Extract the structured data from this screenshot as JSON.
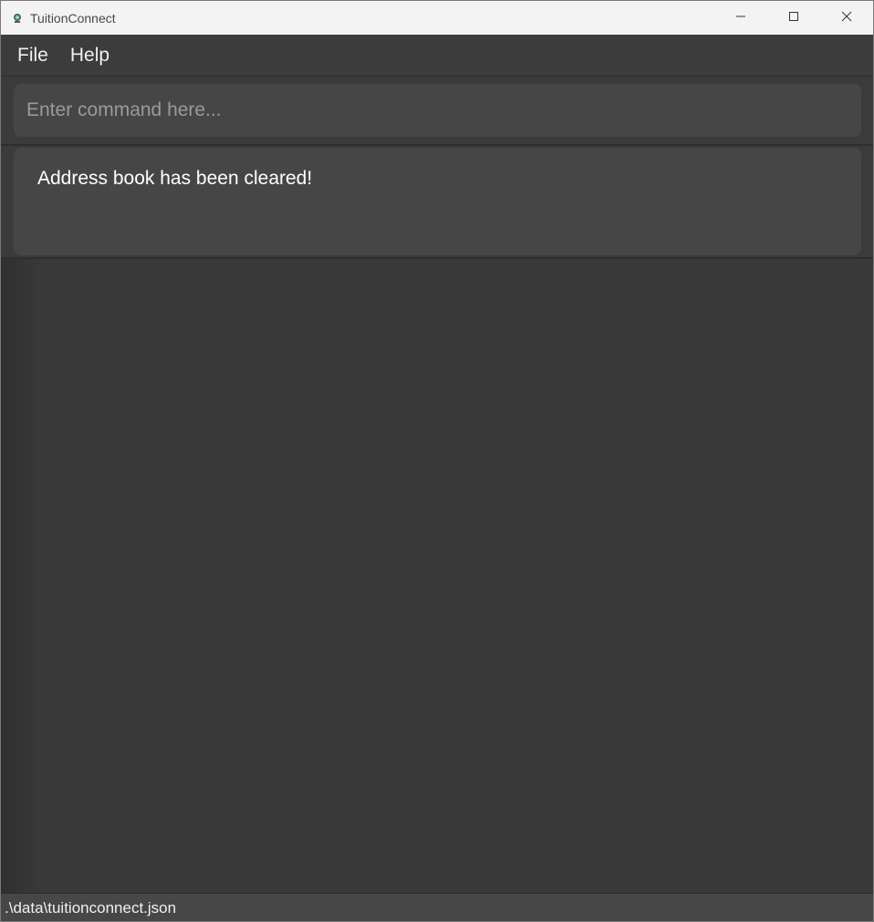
{
  "window": {
    "title": "TuitionConnect",
    "icons": {
      "app": "app-icon",
      "minimize": "minimize-icon",
      "maximize": "maximize-icon",
      "close": "close-icon"
    }
  },
  "menubar": {
    "items": [
      {
        "label": "File"
      },
      {
        "label": "Help"
      }
    ]
  },
  "command": {
    "value": "",
    "placeholder": "Enter command here..."
  },
  "result": {
    "message": "Address book has been cleared!"
  },
  "statusbar": {
    "path": ".\\data\\tuitionconnect.json"
  },
  "colors": {
    "background": "#383838",
    "panel": "#464646",
    "titlebar": "#f3f3f3",
    "text": "#ffffff",
    "placeholder": "#9a9a9a"
  }
}
